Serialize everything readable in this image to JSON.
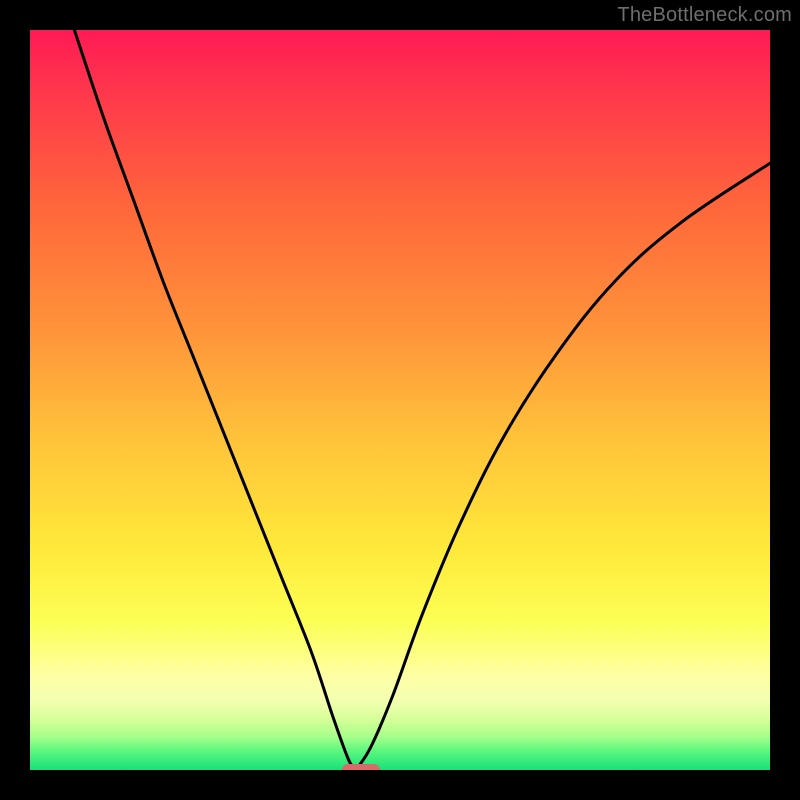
{
  "watermark": {
    "text": "TheBottleneck.com"
  },
  "plot": {
    "inner_width": 740,
    "inner_height": 740,
    "margin": 30
  },
  "gradient": {
    "stops": [
      {
        "offset": 0.0,
        "color": "#ff1a55"
      },
      {
        "offset": 0.1,
        "color": "#ff3c4a"
      },
      {
        "offset": 0.25,
        "color": "#ff6a3a"
      },
      {
        "offset": 0.4,
        "color": "#ff923a"
      },
      {
        "offset": 0.55,
        "color": "#ffc23a"
      },
      {
        "offset": 0.7,
        "color": "#ffe93a"
      },
      {
        "offset": 0.8,
        "color": "#fcff55"
      },
      {
        "offset": 0.875,
        "color": "#feffa6"
      },
      {
        "offset": 0.905,
        "color": "#f4ffb0"
      },
      {
        "offset": 0.93,
        "color": "#d8ff9a"
      },
      {
        "offset": 0.955,
        "color": "#a6ff8a"
      },
      {
        "offset": 0.975,
        "color": "#59f77e"
      },
      {
        "offset": 1.0,
        "color": "#18e07a"
      }
    ]
  },
  "chart_data": {
    "type": "line",
    "title": "",
    "xlabel": "",
    "ylabel": "",
    "xlim": [
      0,
      100
    ],
    "ylim": [
      0,
      100
    ],
    "grid": false,
    "note": "V-shaped bottleneck curve. Values are relative percentages estimated from pixel positions; x is horizontal position (0=left edge of plot, 100=right edge), y is vertical position (0=bottom, 100=top).",
    "minimum_x": 44,
    "series": [
      {
        "name": "left-branch",
        "x": [
          6,
          10,
          14,
          18,
          22,
          26,
          30,
          34,
          38,
          41,
          43,
          44
        ],
        "values": [
          100,
          88,
          77,
          66,
          56,
          46,
          36,
          26,
          16,
          7,
          1.5,
          0
        ]
      },
      {
        "name": "right-branch",
        "x": [
          44,
          46,
          49,
          53,
          58,
          64,
          71,
          79,
          88,
          100
        ],
        "values": [
          0,
          3,
          10,
          21,
          33,
          45,
          56,
          66,
          74,
          82
        ]
      }
    ],
    "marker": {
      "x_start": 42.2,
      "x_end": 47.3,
      "y": 0,
      "color": "#d96a6c"
    }
  }
}
